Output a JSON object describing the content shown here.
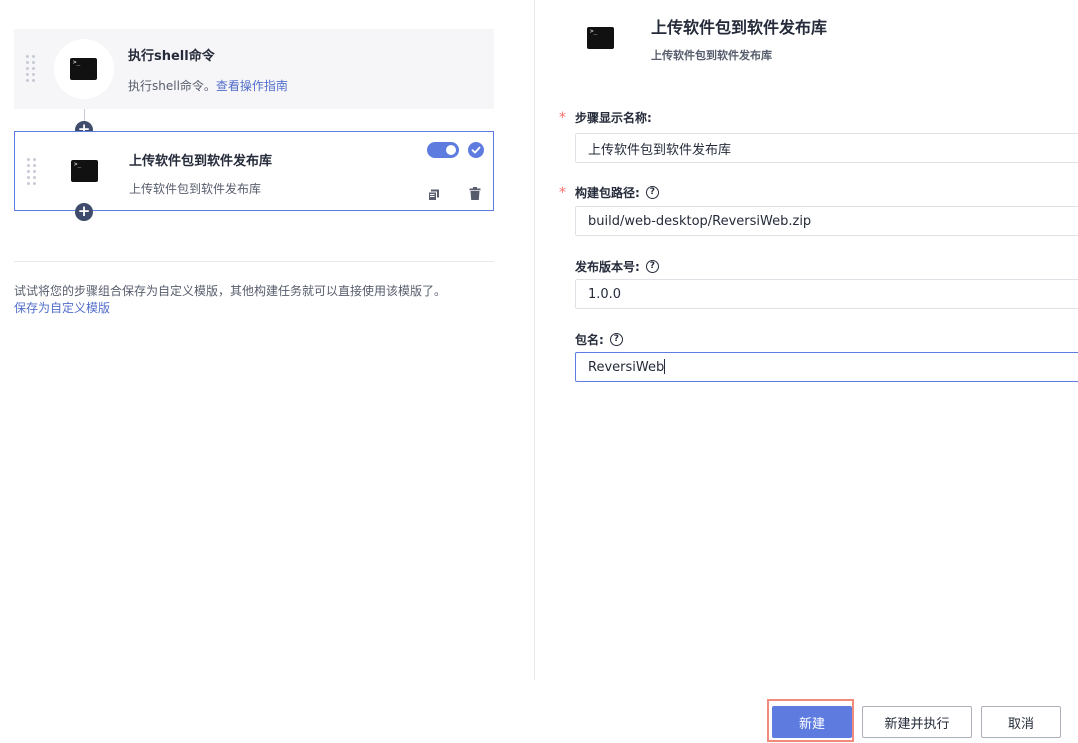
{
  "steps": [
    {
      "title": "执行shell命令",
      "desc": "执行shell命令。",
      "link": "查看操作指南"
    },
    {
      "title": "上传软件包到软件发布库",
      "desc": "上传软件包到软件发布库",
      "enabled": true
    }
  ],
  "template_tip": {
    "text": "试试将您的步骤组合保存为自定义模版，其他构建任务就可以直接使用该模版了。",
    "link": "保存为自定义模版"
  },
  "detail": {
    "title": "上传软件包到软件发布库",
    "subtitle": "上传软件包到软件发布库",
    "fields": {
      "display_name": {
        "label": "步骤显示名称:",
        "value": "上传软件包到软件发布库",
        "required": true
      },
      "build_path": {
        "label": "构建包路径:",
        "value": "build/web-desktop/ReversiWeb.zip",
        "required": true
      },
      "version": {
        "label": "发布版本号:",
        "value": "1.0.0",
        "required": false
      },
      "package_name": {
        "label": "包名:",
        "value": "ReversiWeb",
        "required": false
      }
    },
    "help_glyph": "?"
  },
  "footer": {
    "create_label": "新建",
    "create_run_label": "新建并执行",
    "cancel_label": "取消"
  },
  "colors": {
    "accent": "#5e7ce0",
    "required": "#f66f6a",
    "link": "#526ecc",
    "highlight_frame": "#f08b7e"
  },
  "plus_glyph": "+"
}
